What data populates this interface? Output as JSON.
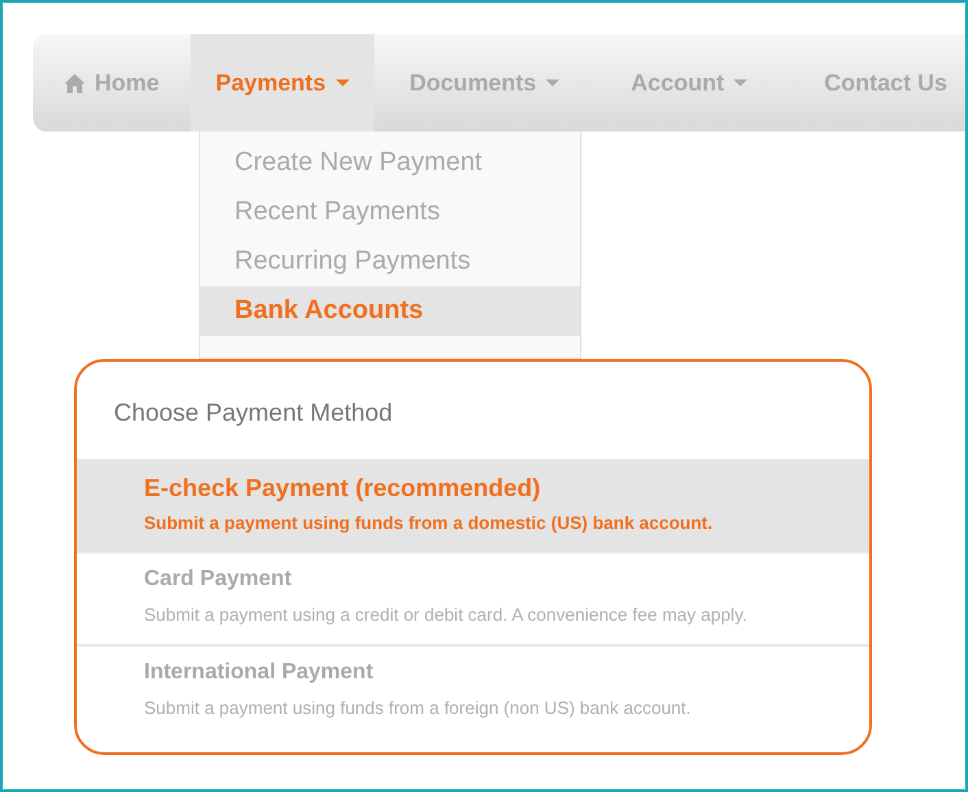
{
  "nav": [
    {
      "label": "Home",
      "kind": "home",
      "selected": false
    },
    {
      "label": "Payments",
      "kind": "dropdown",
      "selected": true
    },
    {
      "label": "Documents",
      "kind": "dropdown",
      "selected": false
    },
    {
      "label": "Account",
      "kind": "dropdown",
      "selected": false
    },
    {
      "label": "Contact Us",
      "kind": "plain",
      "selected": false
    }
  ],
  "dropdown_menu": [
    {
      "label": "Create New Payment",
      "selected": false
    },
    {
      "label": "Recent Payments",
      "selected": false
    },
    {
      "label": "Recurring Payments",
      "selected": false
    },
    {
      "label": "Bank Accounts",
      "selected": true
    }
  ],
  "payment_method": {
    "title": "Choose Payment Method",
    "options": [
      {
        "title": "E-check Payment (recommended)",
        "description": "Submit a payment using funds from a domestic (US) bank account.",
        "selected": true
      },
      {
        "title": "Card Payment",
        "description": "Submit a payment using a credit or debit card. A convenience fee may apply.",
        "selected": false
      },
      {
        "title": "International Payment",
        "description": "Submit a payment using funds from a foreign (non US) bank account.",
        "selected": false
      }
    ]
  }
}
